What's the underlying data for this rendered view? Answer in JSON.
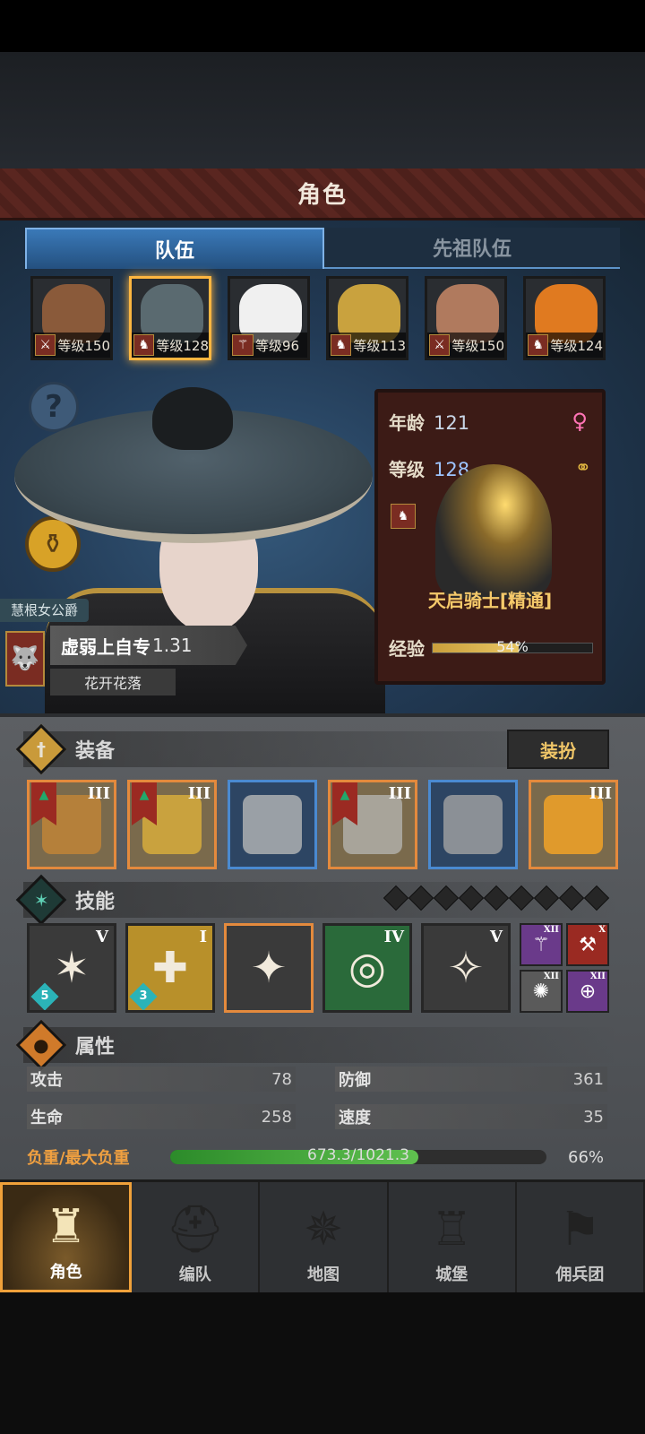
{
  "header": {
    "title": "角色"
  },
  "tabs": [
    {
      "label": "队伍",
      "active": true
    },
    {
      "label": "先祖队伍",
      "active": false
    }
  ],
  "roster": [
    {
      "level": "等级150",
      "class_icon": "sword-icon",
      "selected": false,
      "face_color": "#8a5a3a"
    },
    {
      "level": "等级128",
      "class_icon": "horse-icon",
      "selected": true,
      "face_color": "#5a6a70"
    },
    {
      "level": "等级96",
      "class_icon": "staff-icon",
      "selected": false,
      "face_color": "#f0f0f0"
    },
    {
      "level": "等级113",
      "class_icon": "horse-icon",
      "selected": false,
      "face_color": "#c9a23e"
    },
    {
      "level": "等级150",
      "class_icon": "sword-icon",
      "selected": false,
      "face_color": "#b07a5e"
    },
    {
      "level": "等级124",
      "class_icon": "horse-icon",
      "selected": false,
      "face_color": "#e07a20"
    }
  ],
  "character": {
    "title_tag": "慧根女公爵",
    "trait_name": "虚弱上自专",
    "trait_value": "1.31",
    "subtrait": "花开花落",
    "age_label": "年龄",
    "age": "121",
    "level_label": "等级",
    "level": "128",
    "class_name": "天启骑士[精通]",
    "exp_label": "经验",
    "exp_pct": "54%",
    "exp_fraction": 0.54
  },
  "equipment": {
    "title": "装备",
    "dress_button": "装扮",
    "slots": [
      {
        "tier": "III",
        "rarity": "orange",
        "flag": true,
        "art_color": "#b5803a"
      },
      {
        "tier": "III",
        "rarity": "orange",
        "flag": true,
        "art_color": "#c9a23e"
      },
      {
        "tier": "",
        "rarity": "blue",
        "flag": false,
        "art_color": "#9aa0a6"
      },
      {
        "tier": "III",
        "rarity": "orange",
        "flag": true,
        "art_color": "#a8a49a"
      },
      {
        "tier": "",
        "rarity": "blue",
        "flag": false,
        "art_color": "#8b9096"
      },
      {
        "tier": "III",
        "rarity": "orange",
        "flag": false,
        "art_color": "#e09a2c"
      }
    ]
  },
  "skills": {
    "title": "技能",
    "items": [
      {
        "tier": "V",
        "count": "5",
        "bg": "#3a3a3a",
        "glyph": "✶"
      },
      {
        "tier": "I",
        "count": "3",
        "bg": "#b8902a",
        "glyph": "✚"
      },
      {
        "tier": "",
        "count": "",
        "bg": "#3a3a3a",
        "glyph": "✦"
      },
      {
        "tier": "IV",
        "count": "",
        "bg": "#2a6a3a",
        "glyph": "◎"
      },
      {
        "tier": "V",
        "count": "",
        "bg": "#3a3a3a",
        "glyph": "✧"
      }
    ],
    "mini": [
      {
        "tier": "XII",
        "bg": "#6a3a8a",
        "glyph": "⚚"
      },
      {
        "tier": "X",
        "bg": "#9a2a22",
        "glyph": "⚒"
      },
      {
        "tier": "XII",
        "bg": "#5a5a5a",
        "glyph": "✺"
      },
      {
        "tier": "XII",
        "bg": "#6a3a8a",
        "glyph": "⊕"
      }
    ]
  },
  "attributes": {
    "title": "属性",
    "attack_label": "攻击",
    "attack": "78",
    "defense_label": "防御",
    "defense": "361",
    "hp_label": "生命",
    "hp": "258",
    "speed_label": "速度",
    "speed": "35",
    "weight_label": "负重/最大负重",
    "weight_text": "673.3/1021.3",
    "weight_pct": "66%",
    "weight_fraction": 0.66
  },
  "nav": [
    {
      "label": "角色",
      "icon": "knight-icon",
      "active": true
    },
    {
      "label": "编队",
      "icon": "helmet-icon",
      "active": false
    },
    {
      "label": "地图",
      "icon": "compass-icon",
      "active": false
    },
    {
      "label": "城堡",
      "icon": "castle-icon",
      "active": false
    },
    {
      "label": "佣兵团",
      "icon": "flag-icon",
      "active": false
    }
  ]
}
